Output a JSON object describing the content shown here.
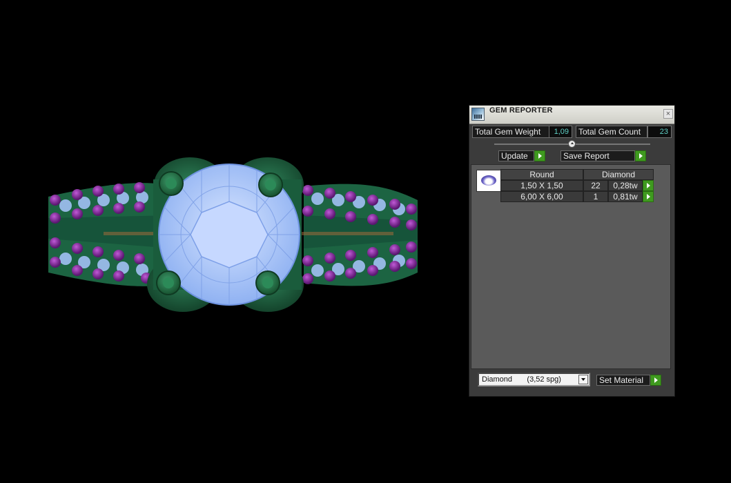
{
  "panel": {
    "title": "GEM REPORTER",
    "close_glyph": "×",
    "total_gem_weight_label": "Total Gem Weight",
    "total_gem_weight_value": "1,09",
    "total_gem_count_label": "Total Gem Count",
    "total_gem_count_value": "23",
    "update_label": "Update",
    "save_report_label": "Save Report",
    "table": {
      "headers": [
        "Round",
        "Diamond"
      ],
      "rows": [
        {
          "size": "1,50 X 1,50",
          "count": "22",
          "weight": "0,28tw"
        },
        {
          "size": "6,00 X 6,00",
          "count": "1",
          "weight": "0,81tw"
        }
      ]
    },
    "material_selected": "Diamond       (3,52 spg)",
    "set_material_label": "Set Material"
  },
  "colors": {
    "background": "#000000",
    "metal": "#1f6a45",
    "gem": "#a9c6ff",
    "accent_stone": "#8a2aa0",
    "go_button": "#3f9a1f",
    "value_text": "#5fd0c6"
  },
  "icons": {
    "title": "gem-reporter-app-icon",
    "close": "close-icon",
    "go": "play-arrow-icon",
    "dropdown": "chevron-down-icon",
    "thumbnail": "round-gem-icon"
  }
}
